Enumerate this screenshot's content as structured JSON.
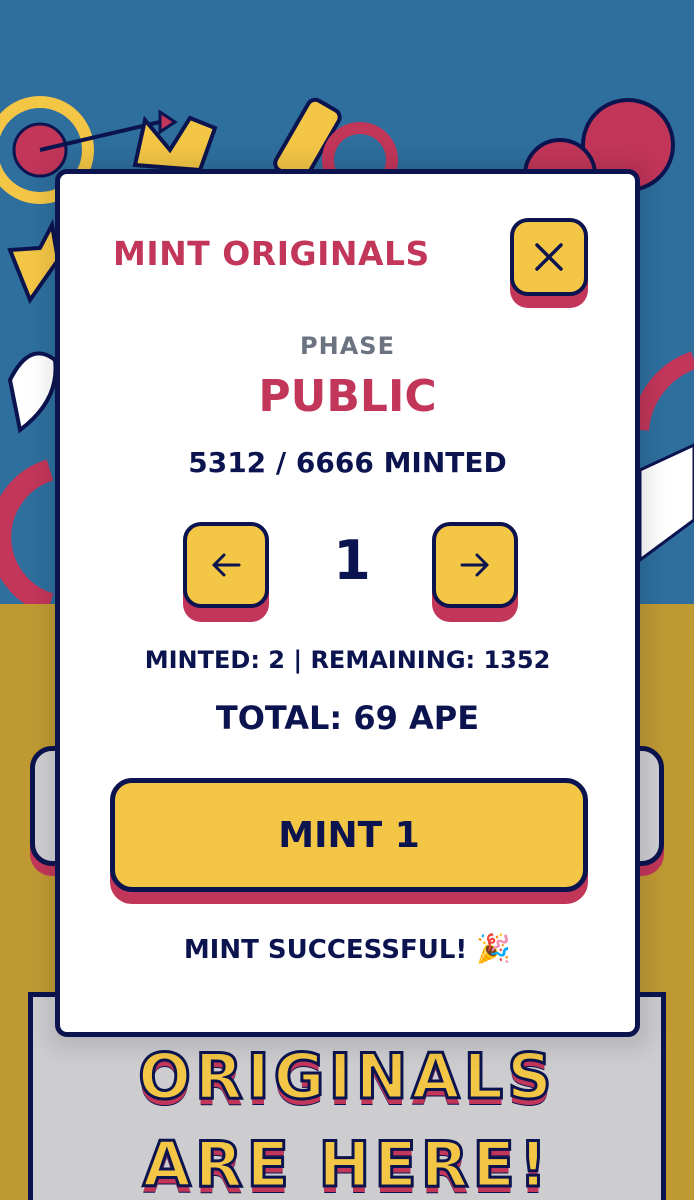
{
  "colors": {
    "background_top": "#2e6f9e",
    "background_bottom": "#bf9a33",
    "accent_red": "#c2365a",
    "accent_yellow": "#f4c646",
    "navy": "#0c1450",
    "muted_gray": "#6b7280"
  },
  "hero": {
    "line1": "ORIGINALS",
    "line2": "ARE HERE!"
  },
  "modal": {
    "title": "MINT ORIGINALS",
    "close_icon": "close-icon",
    "phase_label": "PHASE",
    "phase_value": "PUBLIC",
    "minted_count": "5312 / 6666 MINTED",
    "quantity": "1",
    "decrement_icon": "arrow-left-icon",
    "increment_icon": "arrow-right-icon",
    "stats": "MINTED: 2 | REMAINING: 1352",
    "total": "TOTAL: 69 APE",
    "mint_button": "MINT 1",
    "success_message": "MINT SUCCESSFUL!",
    "success_icon": "party-popper-icon",
    "success_emoji": "🎉"
  }
}
